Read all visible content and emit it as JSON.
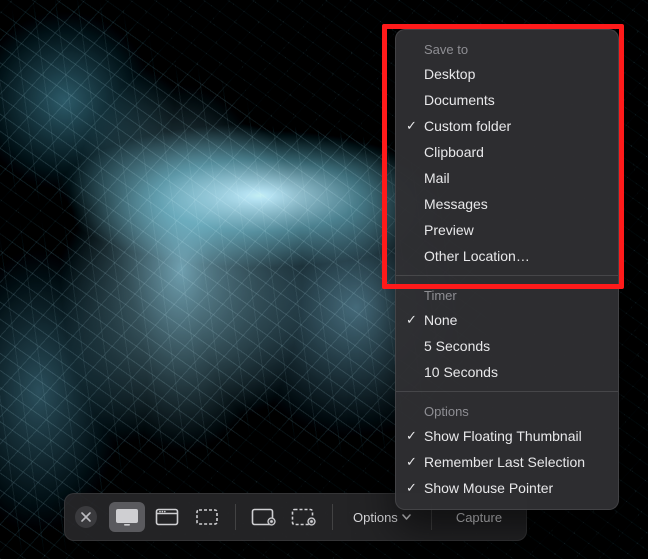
{
  "toolbar": {
    "close_label": "Close",
    "entire_screen_label": "Capture Entire Screen",
    "window_label": "Capture Selected Window",
    "selection_label": "Capture Selected Portion",
    "record_screen_label": "Record Entire Screen",
    "record_selection_label": "Record Selected Portion",
    "options_label": "Options",
    "capture_label": "Capture"
  },
  "menu": {
    "sections": [
      {
        "header": "Save to",
        "items": [
          {
            "label": "Desktop",
            "checked": false
          },
          {
            "label": "Documents",
            "checked": false
          },
          {
            "label": "Custom folder",
            "checked": true
          },
          {
            "label": "Clipboard",
            "checked": false
          },
          {
            "label": "Mail",
            "checked": false
          },
          {
            "label": "Messages",
            "checked": false
          },
          {
            "label": "Preview",
            "checked": false
          },
          {
            "label": "Other Location…",
            "checked": false
          }
        ]
      },
      {
        "header": "Timer",
        "items": [
          {
            "label": "None",
            "checked": true
          },
          {
            "label": "5 Seconds",
            "checked": false
          },
          {
            "label": "10 Seconds",
            "checked": false
          }
        ]
      },
      {
        "header": "Options",
        "items": [
          {
            "label": "Show Floating Thumbnail",
            "checked": true
          },
          {
            "label": "Remember Last Selection",
            "checked": true
          },
          {
            "label": "Show Mouse Pointer",
            "checked": true
          }
        ]
      }
    ]
  }
}
